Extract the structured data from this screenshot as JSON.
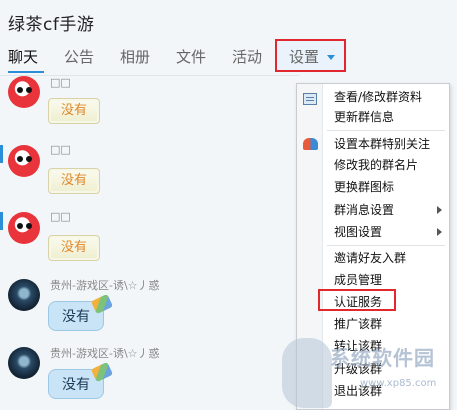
{
  "header": {
    "title": "绿茶cf手游"
  },
  "tabs": [
    {
      "label": "聊天",
      "active": true
    },
    {
      "label": "公告"
    },
    {
      "label": "相册"
    },
    {
      "label": "文件"
    },
    {
      "label": "活动"
    },
    {
      "label": "设置",
      "has_dropdown": true
    }
  ],
  "messages": [
    {
      "sender": "□□",
      "text": "没有",
      "avatar": "red-bird-avatar"
    },
    {
      "sender": "□□",
      "text": "没有",
      "avatar": "red-bird-avatar"
    },
    {
      "sender": "□□",
      "text": "没有",
      "avatar": "red-bird-avatar"
    },
    {
      "sender": "贵州-游戏区-诱\\☆丿惑",
      "text": "没有",
      "avatar": "dark-avatar"
    },
    {
      "sender": "贵州-游戏区-诱\\☆丿惑",
      "text": "没有",
      "avatar": "dark-avatar"
    }
  ],
  "settings_menu": {
    "items": [
      {
        "label": "查看/修改群资料",
        "icon": "document-icon"
      },
      {
        "label": "更新群信息"
      },
      {
        "label": "设置本群特别关注",
        "icon": "heart-icon"
      },
      {
        "label": "修改我的群名片"
      },
      {
        "label": "更换群图标"
      },
      {
        "label": "群消息设置",
        "submenu": true
      },
      {
        "label": "视图设置",
        "submenu": true
      },
      {
        "label": "邀请好友入群"
      },
      {
        "label": "成员管理"
      },
      {
        "label": "认证服务",
        "highlighted": true
      },
      {
        "label": "推广该群"
      },
      {
        "label": "转让该群"
      },
      {
        "label": "升级该群"
      },
      {
        "label": "退出该群"
      }
    ]
  },
  "watermark": {
    "text": "系统软件园",
    "url": "www.xp85.com"
  },
  "colors": {
    "accent": "#2b8fd8",
    "highlight_border": "#e0282e",
    "bubble_text": "#e0882a"
  }
}
